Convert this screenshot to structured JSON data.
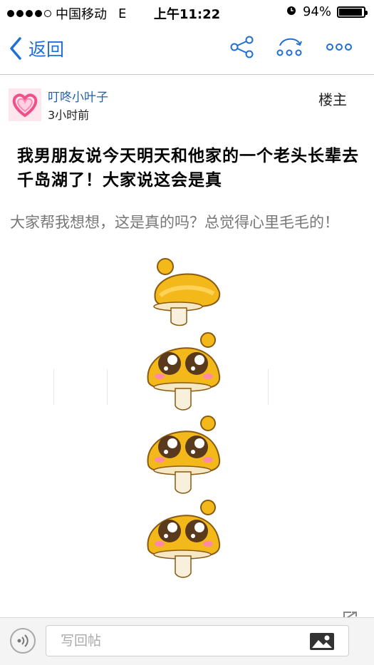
{
  "status_bar": {
    "carrier": "中国移动",
    "network": "E",
    "time": "上午11:22",
    "battery": "94%"
  },
  "nav": {
    "back_label": "返回",
    "icons": [
      "share-icon",
      "forward-icon",
      "more-icon"
    ]
  },
  "post": {
    "author": "叮咚小叶子",
    "time": "3小时前",
    "floor": "楼主",
    "title": "我男朋友说今天明天和他家的一个老头长辈去千岛湖了！大家说这会是真",
    "body": "大家帮我想想，这是真的吗？总觉得心里毛毛的！",
    "sticker_count": 4
  },
  "reply_bar": {
    "placeholder": "写回帖"
  },
  "colors": {
    "accent": "#1f6fd6",
    "author": "#1f5fb0",
    "sticker": "#f3b91b"
  }
}
